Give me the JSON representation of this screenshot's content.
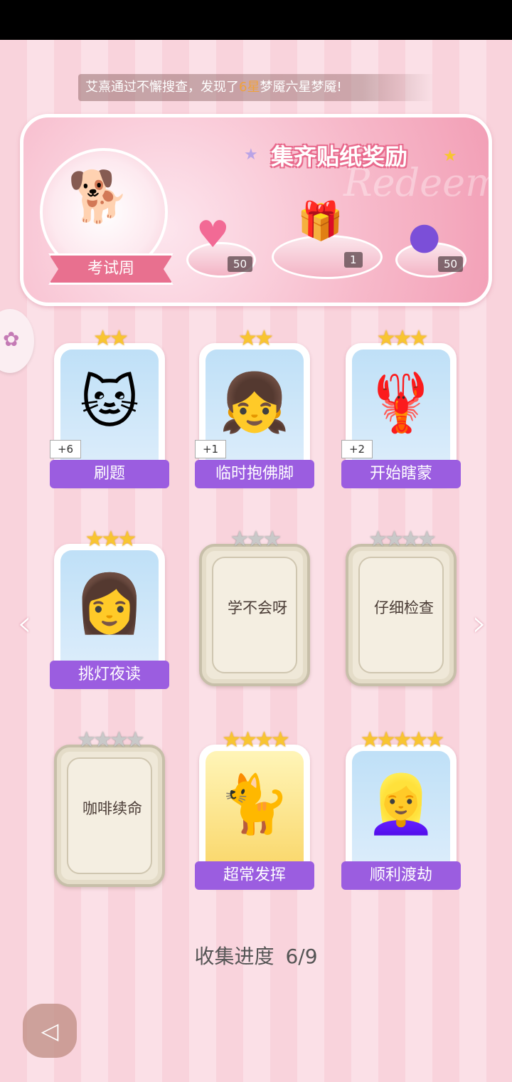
{
  "ticker": {
    "prefix": "艾熹通过不懈搜查，发现了",
    "highlight": "6星",
    "suffix": "梦魇六星梦魇!"
  },
  "reward": {
    "title": "集齐贴纸奖励",
    "watermark": "Redeem",
    "badge_label": "考试周",
    "items": [
      {
        "icon": "heart-gem-icon",
        "count": "50"
      },
      {
        "icon": "gift-box-icon",
        "count": "1"
      },
      {
        "icon": "purple-orb-icon",
        "count": "50"
      }
    ]
  },
  "cards": [
    {
      "name": "刷题",
      "stars": 2,
      "unlocked": true,
      "plus": "+6",
      "art": "🐱"
    },
    {
      "name": "临时抱佛脚",
      "stars": 2,
      "unlocked": true,
      "plus": "+1",
      "art": "👧"
    },
    {
      "name": "开始瞎蒙",
      "stars": 3,
      "unlocked": true,
      "plus": "+2",
      "art": "🦞"
    },
    {
      "name": "挑灯夜读",
      "stars": 3,
      "unlocked": true,
      "plus": "",
      "art": "👩"
    },
    {
      "name": "学不会呀",
      "stars": 3,
      "unlocked": false
    },
    {
      "name": "仔细检查",
      "stars": 4,
      "unlocked": false
    },
    {
      "name": "咖啡续命",
      "stars": 4,
      "unlocked": false
    },
    {
      "name": "超常发挥",
      "stars": 4,
      "unlocked": true,
      "plus": "",
      "art": "🐈",
      "gold": true
    },
    {
      "name": "顺利渡劫",
      "stars": 5,
      "unlocked": true,
      "plus": "",
      "art": "👱‍♀️"
    }
  ],
  "progress": {
    "label": "收集进度",
    "value": "6/9"
  },
  "nav": {
    "prev": "‹",
    "next": "›",
    "back": "◁"
  },
  "colors": {
    "card_label": "#9b5de0",
    "badge": "#e8708f",
    "highlight": "#f0a23a"
  }
}
